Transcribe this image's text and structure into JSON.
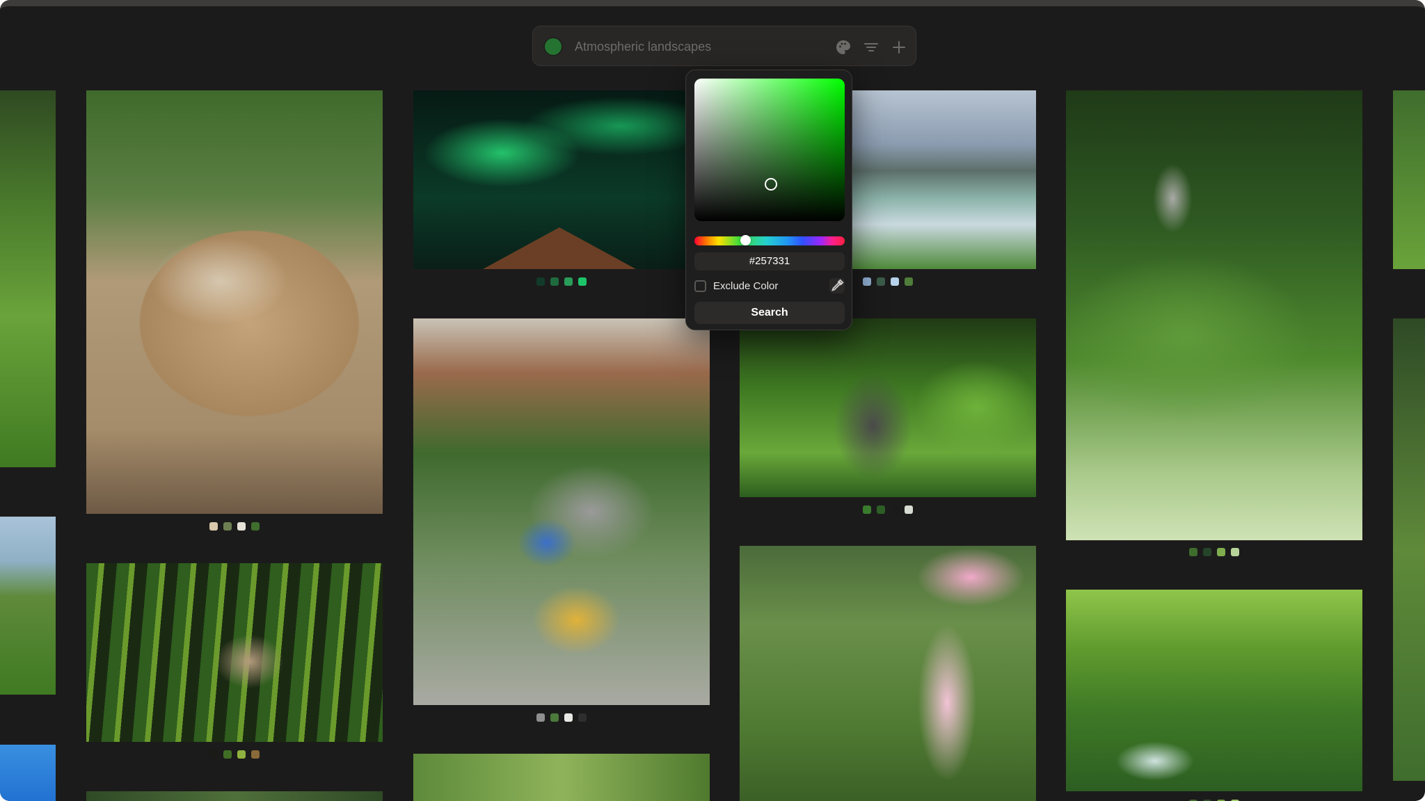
{
  "search": {
    "placeholder": "Atmospheric landscapes",
    "selected_color": "#257331",
    "icons": [
      "palette-icon",
      "filter-lines-icon",
      "plus-icon"
    ]
  },
  "color_picker": {
    "hex_value": "#257331",
    "exclude_label": "Exclude Color",
    "exclude_checked": false,
    "search_label": "Search",
    "eyedropper_icon": "eyedropper-icon"
  },
  "gallery": {
    "tiles": [
      {
        "subject": "wicker-basket-flowers",
        "palette": [
          "#d8c9ad",
          "#6d7f52",
          "#e6e2d8",
          "#3f6e2d"
        ]
      },
      {
        "subject": "aurora-cabin",
        "palette": [
          "#123a2a",
          "#1f6a3f",
          "#2a9c5a",
          "#1cc46a"
        ]
      },
      {
        "subject": "mountain-lake",
        "palette": [
          "#8faed0",
          "#3b5c4a",
          "#b7d3ec",
          "#4f7d3a"
        ]
      },
      {
        "subject": "owl-in-forest",
        "palette": [
          "#3f6d2d",
          "#25442a",
          "#7fae4f",
          "#b6d39a"
        ]
      },
      {
        "subject": "origami-cranes",
        "palette": [
          "#8f8f8f",
          "#4c7a3a",
          "#e9e9e4",
          "#2e2e2e"
        ]
      },
      {
        "subject": "kitten-in-leaves",
        "palette": [
          "#3a7c2d",
          "#2c5e25",
          "#1a1a1a",
          "#d7dcd2"
        ]
      },
      {
        "subject": "duck-in-reeds",
        "palette": [
          "#1a1a16",
          "#3f6e24",
          "#8fb13f",
          "#8a6a3a"
        ]
      },
      {
        "subject": "soccer-player",
        "palette": []
      },
      {
        "subject": "mossy-waterfall",
        "palette": [
          "#3f6d2d",
          "#2c5028",
          "#6f9f3c",
          "#9ccc6a"
        ]
      }
    ]
  }
}
